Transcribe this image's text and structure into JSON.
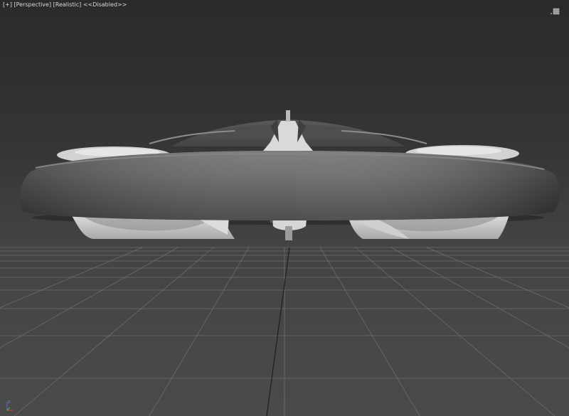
{
  "viewport": {
    "label_plus": "[+]",
    "label_view": "[Perspective]",
    "label_shading": "[Realistic]",
    "label_status": "<<Disabled>>"
  },
  "gizmo": {
    "axis_z": "z"
  },
  "icons": {
    "viewcube": "viewcube-icon",
    "axis": "axis-tripod-icon"
  },
  "colors": {
    "background": "#353535",
    "grid": "#6a6a6a",
    "model_body": "#5e5e5e",
    "model_highlight": "#cfcfcf"
  }
}
